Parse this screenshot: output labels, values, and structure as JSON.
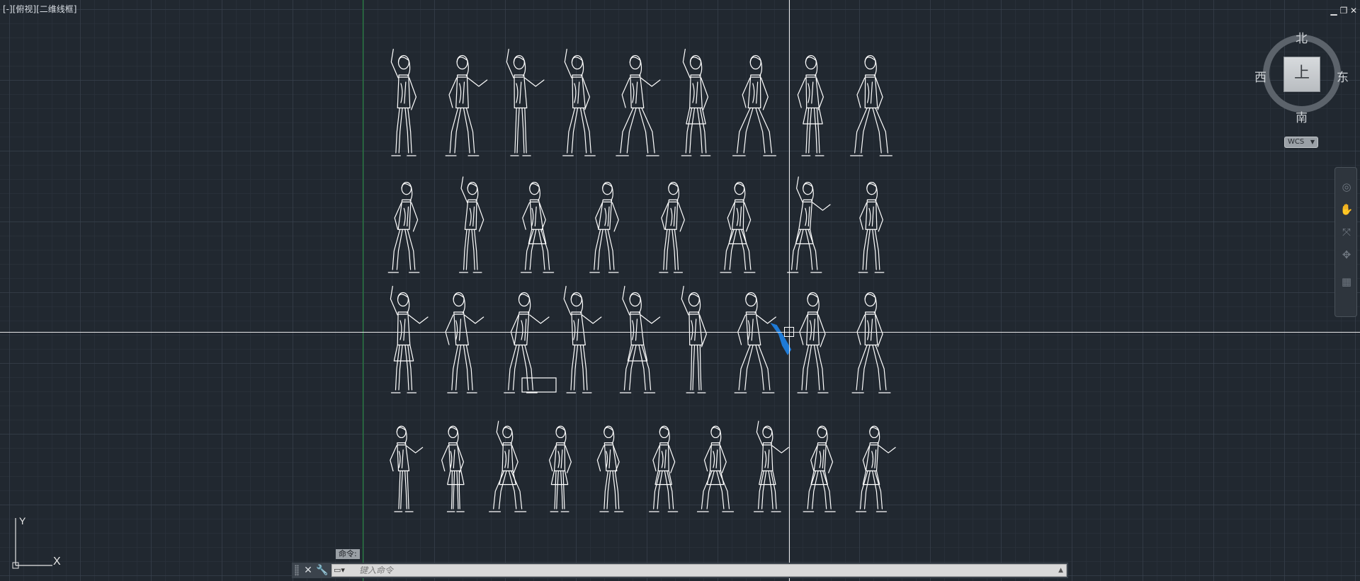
{
  "viewport": {
    "label_parts": [
      "[-]",
      "[俯视]",
      "[二维线框]"
    ],
    "window_controls": {
      "minimize": "▁",
      "restore": "❐",
      "close": "✕"
    }
  },
  "viewcube": {
    "top_face": "上",
    "north": "北",
    "south": "南",
    "east": "东",
    "west": "西",
    "coordinate_system": "WCS"
  },
  "ucs": {
    "x_label": "X",
    "y_label": "Y"
  },
  "command_line": {
    "history_text": "命令:",
    "placeholder": "键入命令",
    "close_icon": "close-icon",
    "customize_icon": "wrench-icon",
    "command_icon": "command-prompt-icon"
  },
  "navigation_bar": {
    "tools": [
      "steering-wheel-icon",
      "pan-icon",
      "zoom-icon",
      "orbit-icon",
      "showmotion-icon"
    ]
  },
  "drawing": {
    "rows": 4,
    "figures_per_row": [
      9,
      8,
      9,
      10
    ],
    "line_color": "#ffffff",
    "selection_color": "#1e7ad6"
  }
}
